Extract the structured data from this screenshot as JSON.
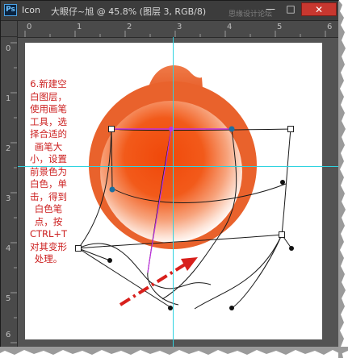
{
  "app": {
    "badge": "Ps",
    "name": "Icon",
    "document_title": "大眼仔~旭 @ 45.8% (图层 3, RGB/8)",
    "watermark": "思缘设计论坛"
  },
  "window_controls": {
    "minimize": "—",
    "maximize": "□",
    "close": "✕"
  },
  "ruler_top": [
    "0",
    "1",
    "2",
    "3",
    "4",
    "5",
    "6",
    "7",
    "8"
  ],
  "ruler_left": [
    "0",
    "1",
    "2",
    "3",
    "4",
    "5",
    "6"
  ],
  "instruction": "6.新建空白图层，使用画笔工具，选择合适的画笔大小，设置前景色为白色，单击，得到白色笔点，按CTRL+T对其变形处理。",
  "colors": {
    "workspace": "#535353",
    "canvas": "#ffffff",
    "orange_outer": "#e8612c",
    "orange_inner": "#f2530f",
    "guide": "#2fd3e0",
    "path_selected": "#c030e0",
    "instruction_text": "#cc1f1f",
    "arrow": "#d8201c"
  },
  "icons": {
    "app_badge": "photoshop-logo-icon",
    "arrow": "dash-dot-arrow-icon"
  }
}
